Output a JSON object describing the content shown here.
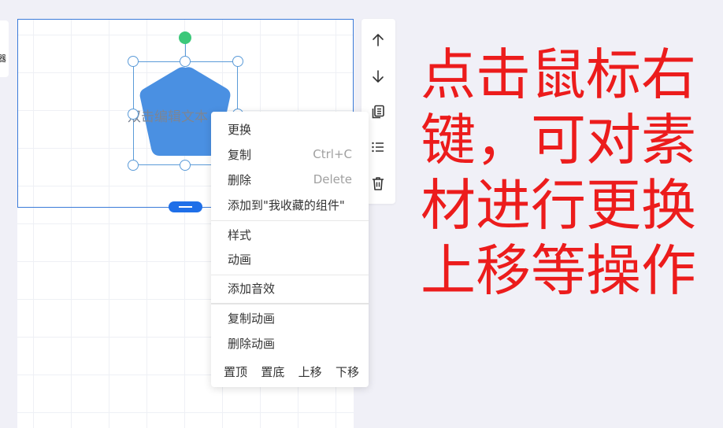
{
  "left_panel": {
    "stub_text": "器"
  },
  "shape": {
    "text": "双击编辑文本",
    "fill_color": "#4a90e2",
    "rotate_handle_color": "#3cc87a"
  },
  "toolbar": {
    "buttons": [
      {
        "name": "move-up",
        "icon": "arrow-up-icon"
      },
      {
        "name": "move-down",
        "icon": "arrow-down-icon"
      },
      {
        "name": "copy",
        "icon": "copy-icon"
      },
      {
        "name": "list",
        "icon": "list-icon"
      },
      {
        "name": "delete",
        "icon": "trash-icon"
      }
    ]
  },
  "context_menu": {
    "replace": "更换",
    "copy": "复制",
    "copy_shortcut": "Ctrl+C",
    "delete": "删除",
    "delete_shortcut": "Delete",
    "add_to_favorites": "添加到\"我收藏的组件\"",
    "style": "样式",
    "animation": "动画",
    "add_sound": "添加音效",
    "copy_animation": "复制动画",
    "delete_animation": "删除动画",
    "order": {
      "top": "置顶",
      "bottom": "置底",
      "up": "上移",
      "down": "下移"
    }
  },
  "caption": {
    "lines": [
      "点击鼠标右",
      "键，可对素",
      "材进行更换",
      "上移等操作"
    ],
    "color": "#ec1c1c"
  },
  "colors": {
    "accent": "#1f6fe8",
    "selection_border": "#3b7bd9"
  }
}
